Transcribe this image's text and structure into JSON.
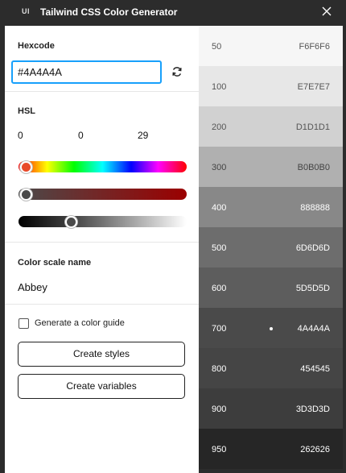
{
  "window": {
    "logo": "UI",
    "title": "Tailwind CSS Color Generator",
    "close_icon": "close-icon"
  },
  "hexcode": {
    "label": "Hexcode",
    "value": "#4A4A4A",
    "refresh_icon": "refresh-icon"
  },
  "hsl": {
    "label": "HSL",
    "h": "0",
    "s": "0",
    "l": "29",
    "hue_level": 0.0,
    "saturation_level": 0.0,
    "lightness_level": 0.29
  },
  "scale": {
    "label": "Color scale name",
    "value": "Abbey"
  },
  "guide": {
    "checkbox_label": "Generate a color guide",
    "checked": false
  },
  "actions": {
    "create_styles": "Create styles",
    "create_variables": "Create variables"
  },
  "swatches": [
    {
      "shade": "50",
      "hex": "F6F6F6",
      "color": "#f6f6f6",
      "text_color": "#555555"
    },
    {
      "shade": "100",
      "hex": "E7E7E7",
      "color": "#e7e7e7",
      "text_color": "#555555"
    },
    {
      "shade": "200",
      "hex": "D1D1D1",
      "color": "#d1d1d1",
      "text_color": "#555555"
    },
    {
      "shade": "300",
      "hex": "B0B0B0",
      "color": "#b0b0b0",
      "text_color": "#444444"
    },
    {
      "shade": "400",
      "hex": "888888",
      "color": "#888888",
      "text_color": "#ffffff"
    },
    {
      "shade": "500",
      "hex": "6D6D6D",
      "color": "#6d6d6d",
      "text_color": "#ffffff"
    },
    {
      "shade": "600",
      "hex": "5D5D5D",
      "color": "#5d5d5d",
      "text_color": "#ffffff"
    },
    {
      "shade": "700",
      "hex": "4A4A4A",
      "color": "#4a4a4a",
      "text_color": "#ffffff",
      "selected": true
    },
    {
      "shade": "800",
      "hex": "454545",
      "color": "#454545",
      "text_color": "#ffffff"
    },
    {
      "shade": "900",
      "hex": "3D3D3D",
      "color": "#3d3d3d",
      "text_color": "#ffffff"
    },
    {
      "shade": "950",
      "hex": "262626",
      "color": "#262626",
      "text_color": "#ffffff"
    }
  ]
}
